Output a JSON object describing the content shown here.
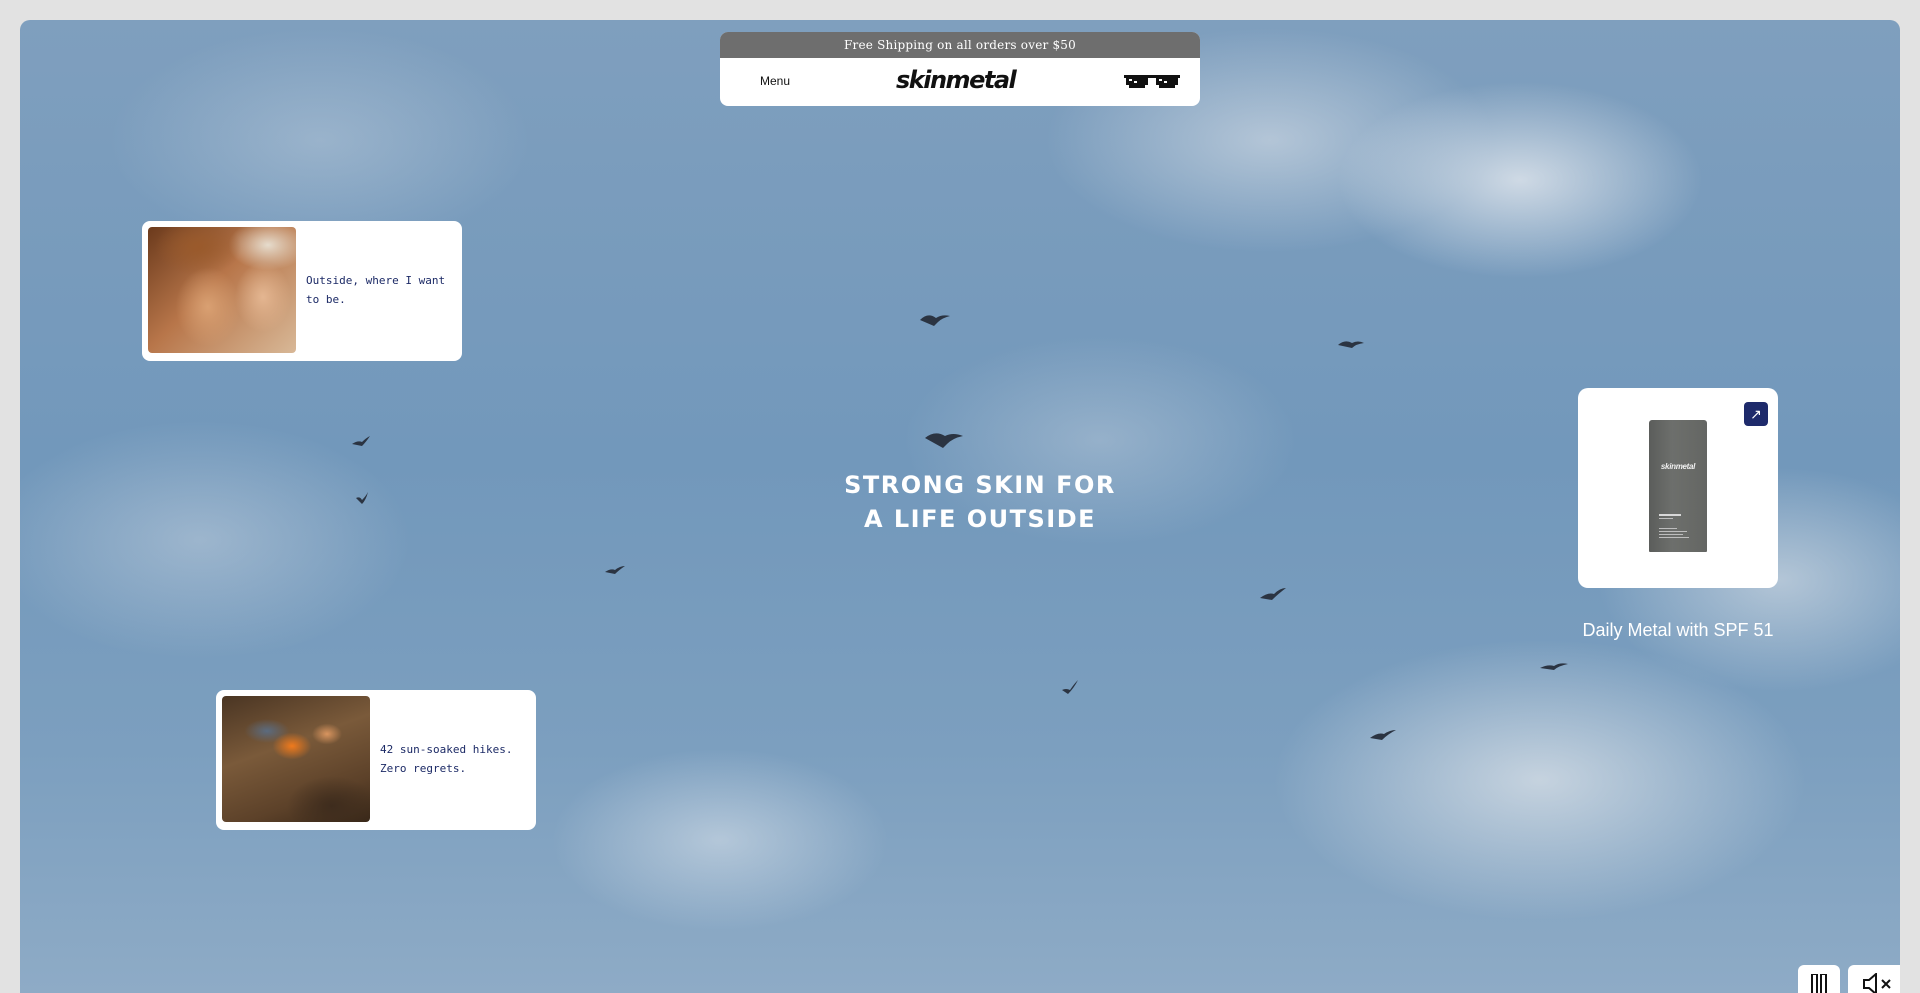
{
  "promo": {
    "text": "Free Shipping on all orders over $50"
  },
  "nav": {
    "menu_label": "Menu",
    "logo_text": "skinmetal",
    "cart_icon": "pixel-sunglasses-icon"
  },
  "hero": {
    "line1": "STRONG SKIN FOR",
    "line2": "A LIFE OUTSIDE"
  },
  "stories": [
    {
      "caption": "Outside, where I want to be."
    },
    {
      "caption": "42 sun-soaked hikes. Zero regrets."
    }
  ],
  "product": {
    "name": "Daily Metal with SPF 51",
    "brand_on_pack": "skinmetal",
    "open_icon": "arrow-up-right-icon"
  },
  "controls": {
    "pause_icon": "pause-icon",
    "mute_icon": "speaker-muted-icon"
  },
  "colors": {
    "promo_bar": "#6e6e6e",
    "caption_text": "#1c2a66",
    "accent_button": "#1e2a6b"
  }
}
